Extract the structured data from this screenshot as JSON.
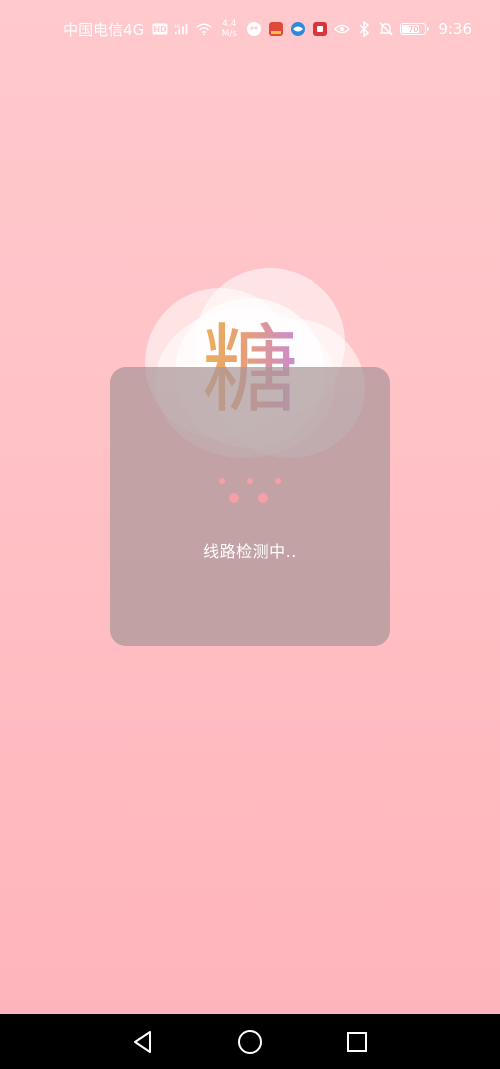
{
  "status_bar": {
    "carrier": "中国电信4G",
    "hd_badge": "HD",
    "signal_label": "4G",
    "net_speed_value": "4.4",
    "net_speed_unit": "M/s",
    "battery_level": "70",
    "time": "9:36",
    "icons": [
      "hd-icon",
      "signal-icon",
      "wifi-icon",
      "net-speed",
      "app-notification-icon",
      "news-icon",
      "browser-icon",
      "app-icon",
      "eye-icon",
      "bluetooth-icon",
      "mute-icon",
      "battery-icon"
    ]
  },
  "logo": {
    "character": "糖",
    "colors": [
      "#e9b25b",
      "#c98ad6"
    ]
  },
  "dialog": {
    "message": "线路检测中.."
  },
  "nav_bar": {
    "icons": [
      "back-icon",
      "home-icon",
      "recents-icon"
    ]
  },
  "colors": {
    "background_top": "#ffc9cd",
    "background_bottom": "#ffb3ba",
    "dialog_bg": "#aa9698",
    "accent_dot": "#f4a0a6"
  }
}
